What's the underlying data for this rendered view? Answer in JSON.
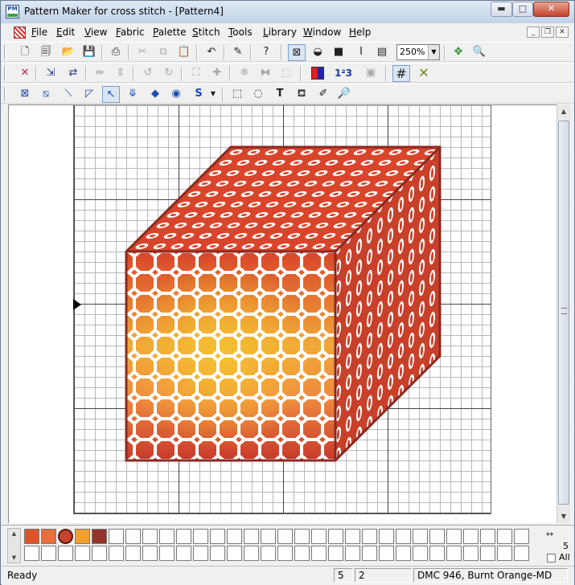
{
  "window": {
    "title": "Pattern Maker for cross stitch - [Pattern4]",
    "app_icon_text": "PM",
    "min_glyph": "▬",
    "max_glyph": "□",
    "close_glyph": "✕"
  },
  "menu": {
    "items": [
      "File",
      "Edit",
      "View",
      "Fabric",
      "Palette",
      "Stitch",
      "Tools",
      "Library",
      "Window",
      "Help"
    ],
    "mdi_min": "_",
    "mdi_restore": "❐",
    "mdi_close": "✕"
  },
  "toolbar": {
    "zoom_value": "250%",
    "zoom_arrow": "▼"
  },
  "palette": {
    "colors": [
      "#e0522a",
      "#e8703a",
      "#c8442a",
      "#f0a030",
      "#96342a"
    ],
    "selected_index": 2,
    "count": "5",
    "all_label": "All",
    "arrows": "↔"
  },
  "statusbar": {
    "ready": "Ready",
    "col": "5",
    "row": "2",
    "color_name": "DMC  946, Burnt Orange-MD"
  },
  "scroll": {
    "up": "▲",
    "down": "▼"
  }
}
